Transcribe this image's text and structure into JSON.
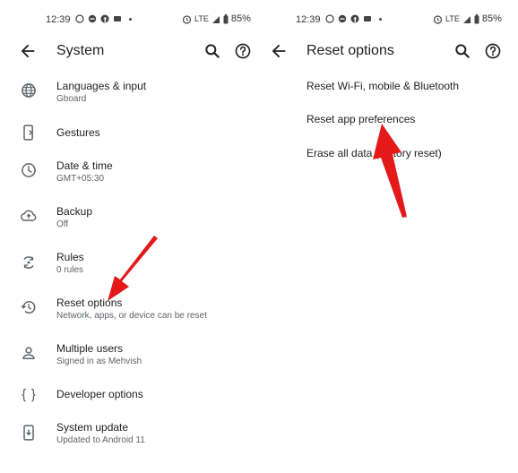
{
  "left_screen": {
    "status": {
      "time": "12:39",
      "battery": "85%",
      "network": "LTE"
    },
    "app_bar": {
      "title": "System"
    },
    "items": [
      {
        "label": "Languages & input",
        "sub": "Gboard",
        "icon": "globe-icon"
      },
      {
        "label": "Gestures",
        "sub": "",
        "icon": "phone-gesture-icon"
      },
      {
        "label": "Date & time",
        "sub": "GMT+05:30",
        "icon": "clock-icon"
      },
      {
        "label": "Backup",
        "sub": "Off",
        "icon": "cloud-upload-icon"
      },
      {
        "label": "Rules",
        "sub": "0 rules",
        "icon": "rules-icon"
      },
      {
        "label": "Reset options",
        "sub": "Network, apps, or device can be reset",
        "icon": "history-icon"
      },
      {
        "label": "Multiple users",
        "sub": "Signed in as Mehvish",
        "icon": "person-icon"
      },
      {
        "label": "Developer options",
        "sub": "",
        "icon": "code-braces-icon"
      },
      {
        "label": "System update",
        "sub": "Updated to Android 11",
        "icon": "system-update-icon"
      }
    ]
  },
  "right_screen": {
    "status": {
      "time": "12:39",
      "battery": "85%",
      "network": "LTE"
    },
    "app_bar": {
      "title": "Reset options"
    },
    "items": [
      {
        "label": "Reset Wi-Fi, mobile & Bluetooth"
      },
      {
        "label": "Reset app preferences"
      },
      {
        "label": "Erase all data (factory reset)"
      }
    ]
  },
  "colors": {
    "arrow": "#e3191a",
    "text": "#202124",
    "subtext": "#5f6368",
    "icon": "#5f6368"
  }
}
